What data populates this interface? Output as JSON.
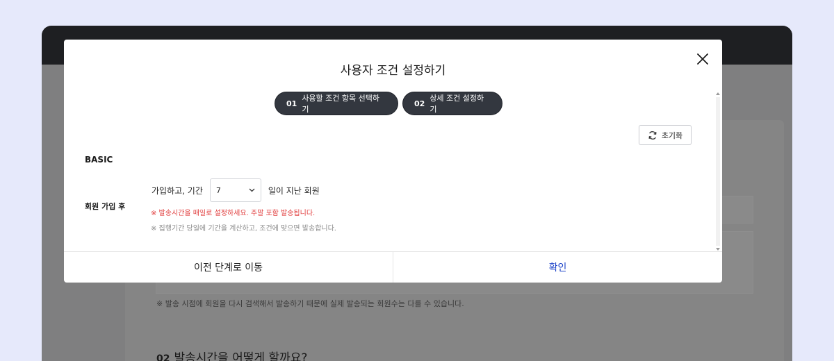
{
  "background": {
    "notice": "※ 발송 시점에 회원을 다시 검색해서 발송하기 때문에 실제 발송되는 회원수는 다를 수 있습니다.",
    "section_number": "02",
    "section_title": "발송시간을 어떻게 할까요?"
  },
  "modal": {
    "title": "사용자 조건 설정하기",
    "steps": [
      {
        "number": "01",
        "label": "사용할 조건 항목 선택하기"
      },
      {
        "number": "02",
        "label": "상세 조건 설정하기"
      }
    ],
    "reset_label": "초기화",
    "section_label": "BASIC",
    "condition": {
      "label": "회원 가입 후",
      "prefix": "가입하고, 기간",
      "select_value": "7",
      "suffix": "일이 지난 회원",
      "note_red": "※ 발송시간을 매일로 설정하세요. 주말 포함 발송됩니다.",
      "note_gray": "※ 집행기간 당일에 기간을 계산하고, 조건에 맞으면 발송합니다."
    },
    "footer": {
      "prev_label": "이전 단계로 이동",
      "confirm_label": "확인"
    }
  },
  "colors": {
    "accent": "#1e44c8",
    "warning": "#e03a3a",
    "step_bg": "#33373f"
  },
  "icons": [
    "close-icon",
    "refresh-icon",
    "chevron-down-icon"
  ]
}
